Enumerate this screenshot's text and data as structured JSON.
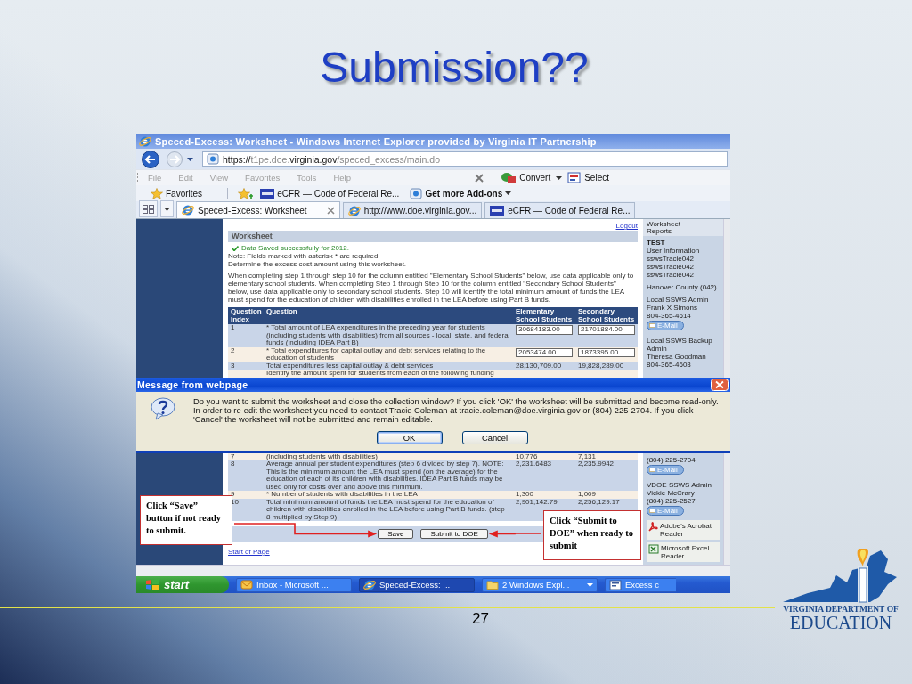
{
  "slide": {
    "title": "Submission??",
    "page_number": "27"
  },
  "logo": {
    "line_1": "VIRGINIA DEPARTMENT OF",
    "line_2": "EDUCATION"
  },
  "browser": {
    "title": "Speced-Excess: Worksheet - Windows Internet Explorer provided by Virginia IT Partnership",
    "url": [
      {
        "text": "https://",
        "dim": false
      },
      {
        "text": "t1pe.doe.",
        "dim": true
      },
      {
        "text": "virginia.gov",
        "dim": false
      },
      {
        "text": "/speced_excess/main.do",
        "dim": true
      }
    ],
    "menu": [
      "File",
      "Edit",
      "View",
      "Favorites",
      "Tools",
      "Help"
    ],
    "commands": [
      {
        "label": "Convert",
        "kind": "convert"
      },
      {
        "label": "Select",
        "kind": "select"
      }
    ],
    "favorites_label": "Favorites",
    "favorites": [
      {
        "label": "eCFR — Code of Federal Re...",
        "kind": "gpo"
      },
      {
        "label": "Get more Add-ons",
        "kind": "addons"
      }
    ],
    "tabs": [
      {
        "label": "Speced-Excess: Worksheet",
        "kind": "ie",
        "selected": true
      },
      {
        "label": "http://www.doe.virginia.gov...",
        "kind": "ie",
        "selected": false
      },
      {
        "label": "eCFR — Code of Federal Re...",
        "kind": "gpo",
        "selected": false
      }
    ]
  },
  "page": {
    "logout": "Logout",
    "heading": "Worksheet",
    "saved_message": "Data Saved successfully for 2012.",
    "notes": [
      "Note: Fields marked with asterisk * are required.",
      "Determine the excess cost amount using this worksheet."
    ],
    "instructions": "When completing step 1 through step 10 for the column entitled \"Elementary School Students\" below, use data applicable only to elementary school students. When completing Step 1 through Step 10 for the column entitled \"Secondary School Students\" below, use data applicable only to secondary school students. Step 10 will identify the total minimum amount of funds the LEA must spend for the education of children with disabilities enrolled in the LEA before using Part B funds.",
    "table": {
      "columns": [
        "Question Index",
        "Question",
        "Elementary School Students",
        "Secondary School Students"
      ],
      "rows_above": [
        {
          "index": "1",
          "question": "* Total amount of LEA expenditures in the preceding year for students (including students with disabilities) from all sources - local, state, and federal funds (including IDEA Part B)",
          "elementary": "30684183.00",
          "secondary": "21701884.00",
          "kind": "input"
        },
        {
          "index": "2",
          "question": "* Total expenditures for capital outlay and debt services relating to the education of students",
          "elementary": "2053474.00",
          "secondary": "1873395.00",
          "kind": "input"
        },
        {
          "index": "3",
          "question": "Total expenditures less capital outlay & debt services",
          "elementary": "28,130,709.00",
          "secondary": "19,828,289.00",
          "kind": "value"
        },
        {
          "question": "Identify the amount spent for students from each of the following funding",
          "kind": "value"
        }
      ],
      "rows_below": [
        {
          "index": "7",
          "question": "(including students with disabilities)",
          "elementary": "10,776",
          "secondary": "7,131",
          "kind": "value"
        },
        {
          "index": "8",
          "question": "Average annual per student expenditures (step 6 divided by step 7). NOTE: This is the minimum amount the LEA must spend (on the average) for the education of each of its children with disabilities. IDEA Part B funds may be used only for costs over and above this minimum.",
          "elementary": "2,231.6483",
          "secondary": "2,235.9942",
          "kind": "value"
        },
        {
          "index": "9",
          "question": "* Number of students with disabilities in the LEA",
          "elementary": "1,300",
          "secondary": "1,009",
          "kind": "value"
        },
        {
          "index": "10",
          "question": "Total minimum amount of funds the LEA must spend for the education of children with disabilities enrolled in the LEA before using Part B funds. (step 8 multiplied by Step 9)",
          "elementary": "2,901,142.79",
          "secondary": "2,256,129.17",
          "kind": "value"
        }
      ]
    },
    "buttons": [
      "Save",
      "Submit to DOE"
    ],
    "start_link": "Start of Page",
    "sidebar_above": [
      {
        "kind": "nav",
        "text": "Worksheet"
      },
      {
        "kind": "nav",
        "text": "Reports"
      },
      {
        "kind": "heading",
        "text": "TEST"
      },
      {
        "kind": "text",
        "text": "User Information"
      },
      {
        "kind": "text",
        "text": "sswsTracie042"
      },
      {
        "kind": "text",
        "text": "sswsTracie042"
      },
      {
        "kind": "text",
        "text": "sswsTracie042"
      },
      {
        "kind": "block",
        "text": "Hanover County (042)"
      },
      {
        "kind": "block",
        "text": "Local SSWS Admin"
      },
      {
        "kind": "text",
        "text": "Frank X Simons"
      },
      {
        "kind": "text",
        "text": "804-365-4614"
      },
      {
        "kind": "email",
        "text": "E-Mail"
      },
      {
        "kind": "block",
        "text": "Local SSWS Backup Admin"
      },
      {
        "kind": "text",
        "text": "Theresa Goodman"
      },
      {
        "kind": "text",
        "text": "804-365-4603"
      }
    ],
    "sidebar_below": [
      {
        "kind": "text",
        "text": "(804) 225-2704"
      },
      {
        "kind": "email",
        "text": "E-Mail"
      },
      {
        "kind": "block",
        "text": "VDOE SSWS Admin"
      },
      {
        "kind": "text",
        "text": "Vickie McCrary"
      },
      {
        "kind": "text",
        "text": "(804) 225-2527"
      },
      {
        "kind": "email",
        "text": "E-Mail"
      },
      {
        "kind": "pdf",
        "text": "Adobe's Acrobat Reader"
      },
      {
        "kind": "excel",
        "text": "Microsoft Excel Reader"
      }
    ]
  },
  "dialog": {
    "title": "Message from webpage",
    "message": "Do you want to submit the worksheet and close the collection window? If you click 'OK' the worksheet will be submitted and become read-only. In order to re-edit the worksheet you need to contact Tracie Coleman at tracie.coleman@doe.virginia.gov or (804) 225-2704. If you click 'Cancel' the worksheet will not be submitted and remain editable.",
    "buttons": [
      {
        "label": "OK",
        "selected": true
      },
      {
        "label": "Cancel",
        "selected": false
      }
    ]
  },
  "taskbar": {
    "start": "start",
    "items": [
      {
        "label": "Inbox - Microsoft ...",
        "kind": "mail",
        "selected": false
      },
      {
        "label": "Speced-Excess: ...",
        "kind": "ie",
        "selected": true
      },
      {
        "label": "2 Windows Expl...",
        "kind": "folder",
        "selected": false
      },
      {
        "label": "Excess c",
        "kind": "doc",
        "selected": false
      }
    ]
  },
  "callouts": [
    {
      "text": "Click “Save” button if not ready to submit."
    },
    {
      "text": "Click “Submit to DOE” when ready to submit"
    }
  ]
}
